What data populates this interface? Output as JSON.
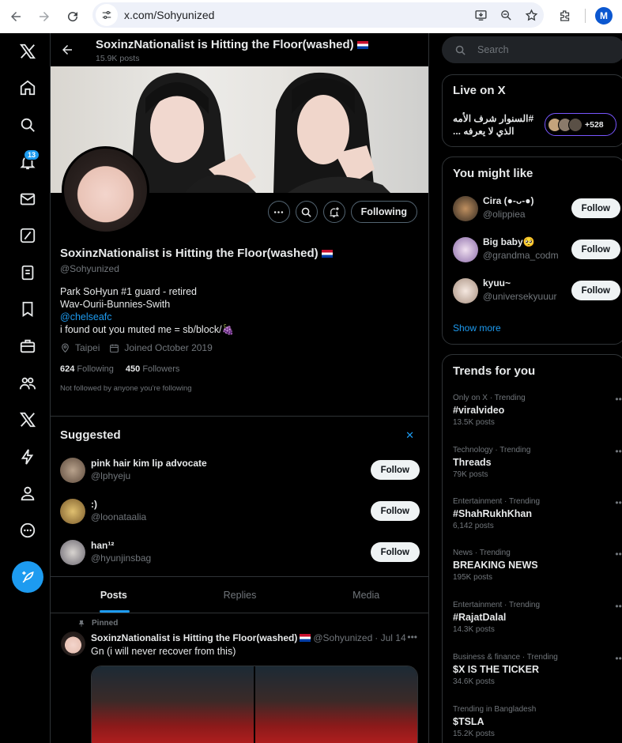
{
  "browser": {
    "url": "x.com/Sohyunized",
    "profile_initial": "M"
  },
  "nav": {
    "notifications_badge": "13"
  },
  "header": {
    "title": "SoxinzNationalist is Hitting the Floor(washed)",
    "posts_count": "15.9K posts"
  },
  "profile": {
    "name": "SoxinzNationalist is Hitting the Floor(washed)",
    "handle": "@Sohyunized",
    "following_label": "Following",
    "bio_line1": "Park SoHyun #1 guard - retired",
    "bio_line2": "Wav-Ourii-Bunnies-Swith",
    "bio_link": "@chelseafc",
    "bio_line4": "i found out you muted me = sb/block/",
    "location": "Taipei",
    "joined": "Joined October 2019",
    "following_count": "624",
    "following_text": "Following",
    "followers_count": "450",
    "followers_text": "Followers",
    "not_followed": "Not followed by anyone you're following"
  },
  "suggested": {
    "title": "Suggested",
    "items": [
      {
        "name": "pink hair kim lip advocate",
        "handle": "@lphyeju",
        "button": "Follow"
      },
      {
        "name": ":)",
        "handle": "@loonataalia",
        "button": "Follow"
      },
      {
        "name": "han¹²",
        "handle": "@hyunjinsbag",
        "button": "Follow"
      }
    ]
  },
  "tabs": [
    {
      "label": "Posts"
    },
    {
      "label": "Replies"
    },
    {
      "label": "Media"
    }
  ],
  "tweet": {
    "pinned": "Pinned",
    "author": "SoxinzNationalist is Hitting the Floor(washed)",
    "handle": "@Sohyunized",
    "date": "· Jul 14",
    "text": "Gn (i will never recover from this)"
  },
  "sidebar": {
    "search_placeholder": "Search",
    "live": {
      "title": "Live on X",
      "topic": "#السنوار شرف الأمه الذي لا يعرفه ...",
      "count": "+528"
    },
    "might_like": {
      "title": "You might like",
      "items": [
        {
          "name": "Cira (●-ᴗ-●)",
          "handle": "@olippiea",
          "button": "Follow"
        },
        {
          "name": "Big baby🥺",
          "handle": "@grandma_codm",
          "button": "Follow"
        },
        {
          "name": "kyuu~",
          "handle": "@universekyuuur",
          "button": "Follow"
        }
      ],
      "show_more": "Show more"
    },
    "trends": {
      "title": "Trends for you",
      "items": [
        {
          "category": "Only on X · Trending",
          "name": "#viralvideo",
          "posts": "13.5K posts"
        },
        {
          "category": "Technology · Trending",
          "name": "Threads",
          "posts": "79K posts"
        },
        {
          "category": "Entertainment · Trending",
          "name": "#ShahRukhKhan",
          "posts": "6,142 posts"
        },
        {
          "category": "News · Trending",
          "name": "BREAKING NEWS",
          "posts": "195K posts"
        },
        {
          "category": "Entertainment · Trending",
          "name": "#RajatDalal",
          "posts": "14.3K posts"
        },
        {
          "category": "Business & finance · Trending",
          "name": "$X IS THE TICKER",
          "posts": "34.6K posts"
        },
        {
          "category": "Trending in Bangladesh",
          "name": "$TSLA",
          "posts": "15.2K posts"
        }
      ]
    }
  }
}
